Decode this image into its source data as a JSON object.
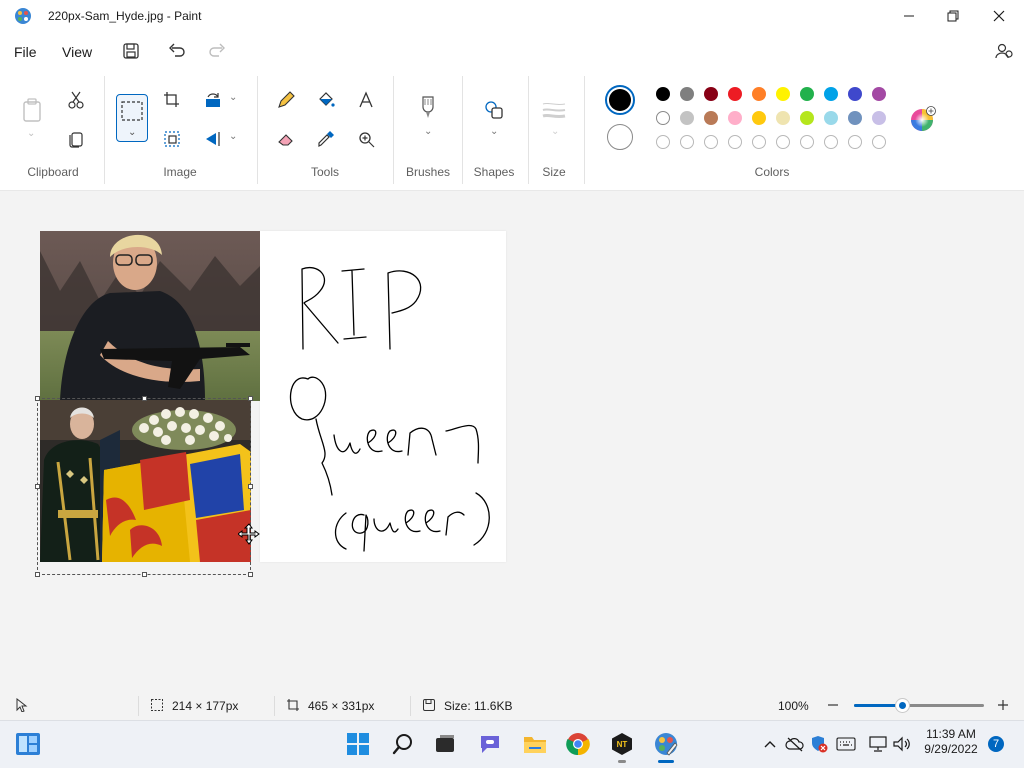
{
  "window": {
    "title": "220px-Sam_Hyde.jpg - Paint",
    "minimize_icon": "minimize-icon",
    "maximize_icon": "maximize-icon",
    "close_icon": "close-icon"
  },
  "menu": {
    "file": "File",
    "view": "View"
  },
  "ribbon": {
    "groups": {
      "clipboard": "Clipboard",
      "image": "Image",
      "tools": "Tools",
      "brushes": "Brushes",
      "shapes": "Shapes",
      "size": "Size",
      "colors": "Colors"
    }
  },
  "colors": {
    "primary": "#000000",
    "secondary": "#ffffff",
    "row1": [
      "#000000",
      "#7f7f7f",
      "#880015",
      "#ed1c24",
      "#ff7f27",
      "#fff200",
      "#22b14c",
      "#00a2e8",
      "#3f48cc",
      "#a349a4"
    ],
    "row2": [
      "#ffffff",
      "#c3c3c3",
      "#b97a57",
      "#ffaec9",
      "#ffc90e",
      "#efe4b0",
      "#b5e61d",
      "#99d9ea",
      "#7092be",
      "#c8bfe7"
    ],
    "row3_empty_count": 10,
    "accent": "#0067c0"
  },
  "canvas": {
    "handwriting_line1": "RIP",
    "handwriting_line2": "Queen",
    "handwriting_line3": "(queer)"
  },
  "status": {
    "selection_size": "214 × 177px",
    "canvas_size": "465 × 331px",
    "file_size": "Size: 11.6KB",
    "zoom": "100%",
    "zoom_level": 0.37
  },
  "taskbar": {
    "time": "11:39 AM",
    "date": "9/29/2022",
    "notification_count": "7"
  }
}
